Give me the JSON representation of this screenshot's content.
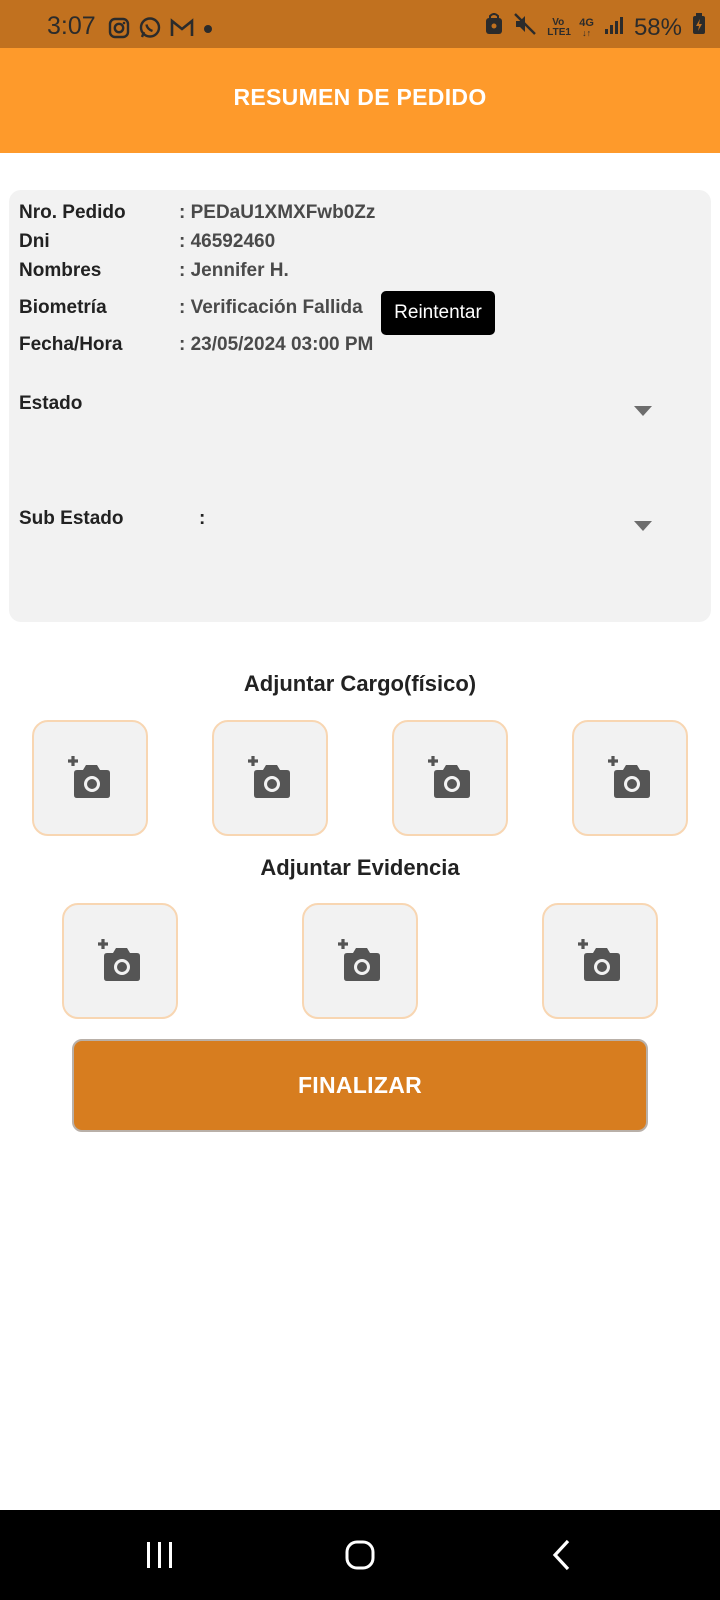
{
  "status_bar": {
    "time": "3:07",
    "left_icons": [
      "instagram-icon",
      "whatsapp-icon",
      "gmail-icon",
      "dot-icon"
    ],
    "volte_label": "Vo LTE1",
    "network": "4G",
    "battery": "58%"
  },
  "header": {
    "title": "RESUMEN DE PEDIDO",
    "color": "#fe9a2b"
  },
  "order": {
    "pedido_label": "Nro. Pedido",
    "pedido_value": ": PEDaU1XMXFwb0Zz",
    "dni_label": "Dni",
    "dni_value": ": 46592460",
    "nombres_label": "Nombres",
    "nombres_value": ": Jennifer H.",
    "biometria_label": "Biometría",
    "biometria_value": ": Verificación Fallida",
    "retry_label": "Reintentar",
    "fecha_label": "Fecha/Hora",
    "fecha_value": ": 23/05/2024 03:00 PM",
    "estado_label": "Estado",
    "estado_value": "",
    "subestado_label": "Sub Estado",
    "subestado_value": ":"
  },
  "cargo_section": {
    "title": "Adjuntar Cargo(físico)",
    "slots": 4
  },
  "evidencia_section": {
    "title": "Adjuntar Evidencia",
    "slots": 3
  },
  "actions": {
    "finalize_label": "FINALIZAR",
    "color": "#d77d1f"
  }
}
